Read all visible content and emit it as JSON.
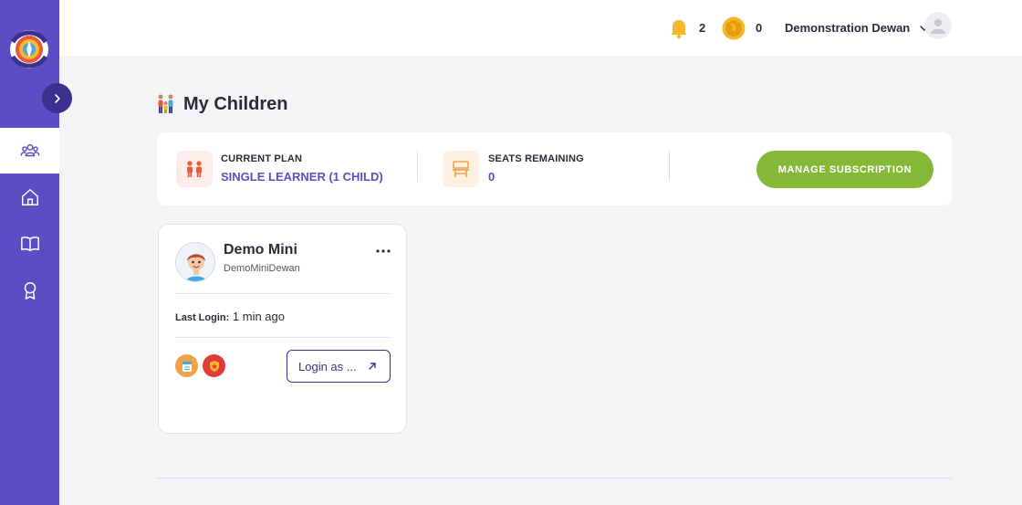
{
  "sidebar": {
    "logo_text": [
      "JOURNEY",
      "2JANNAH"
    ],
    "items": [
      {
        "name": "children",
        "icon": "people-group-icon",
        "active": true
      },
      {
        "name": "home",
        "icon": "home-icon",
        "active": false
      },
      {
        "name": "library",
        "icon": "book-icon",
        "active": false
      },
      {
        "name": "achievements",
        "icon": "award-ribbon-icon",
        "active": false
      }
    ]
  },
  "header": {
    "notifications_count": "2",
    "coins_count": "0",
    "user_name": "Demonstration Dewan"
  },
  "page": {
    "title": "My Children"
  },
  "plan": {
    "current_plan_label": "Current Plan",
    "current_plan_value": "SINGLE LEARNER (1 CHILD)",
    "seats_label": "Seats Remaining",
    "seats_value": "0",
    "manage_label": "MANAGE SUBSCRIPTION"
  },
  "children": [
    {
      "name": "Demo Mini",
      "username": "DemoMiniDewan",
      "last_login_label": "Last Login:",
      "last_login_value": "1 min ago",
      "login_as_label": "Login as ..."
    }
  ],
  "colors": {
    "sidebar": "#5b4ec4",
    "accent_dark": "#3b3190",
    "manage_button": "#86b837",
    "plan_value": "#5b4ec4"
  }
}
